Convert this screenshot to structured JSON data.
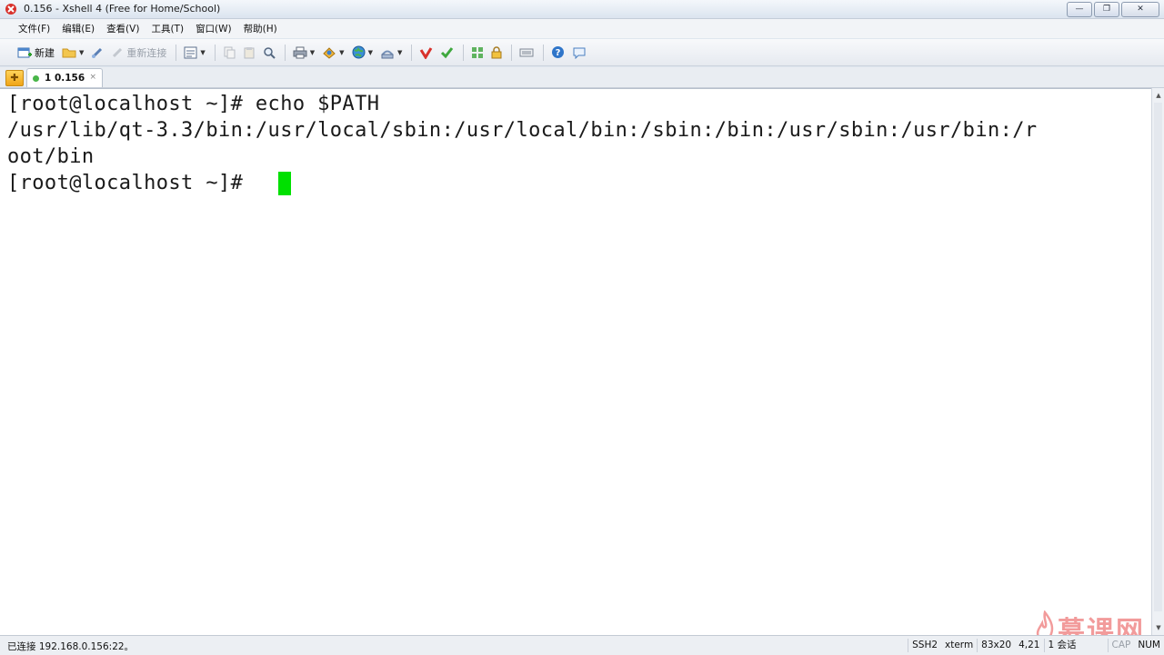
{
  "window": {
    "title": "0.156 - Xshell 4 (Free for Home/School)",
    "buttons": {
      "minimize": "—",
      "maximize": "❐",
      "close": "✕"
    }
  },
  "menu": {
    "items": [
      "文件(F)",
      "编辑(E)",
      "查看(V)",
      "工具(T)",
      "窗口(W)",
      "帮助(H)"
    ]
  },
  "toolbar": {
    "new_label": "新建",
    "reconnect_label": "重新连接"
  },
  "tabs": [
    {
      "label": "1 0.156",
      "close": "×",
      "status_color": "#49b649"
    }
  ],
  "terminal": {
    "lines": [
      "[root@localhost ~]# echo $PATH",
      "/usr/lib/qt-3.3/bin:/usr/local/sbin:/usr/local/bin:/sbin:/bin:/usr/sbin:/usr/bin:/r",
      "oot/bin",
      "[root@localhost ~]# "
    ],
    "cursor_color": "#00e000"
  },
  "status": {
    "connection": "已连接 192.168.0.156:22。",
    "protocol": "SSH2",
    "terminal_type": "xterm",
    "size": "83x20",
    "position": "4,21",
    "sessions": "1 会话",
    "cap": "CAP",
    "num": "NUM"
  },
  "watermark": {
    "text": "慕课网"
  }
}
